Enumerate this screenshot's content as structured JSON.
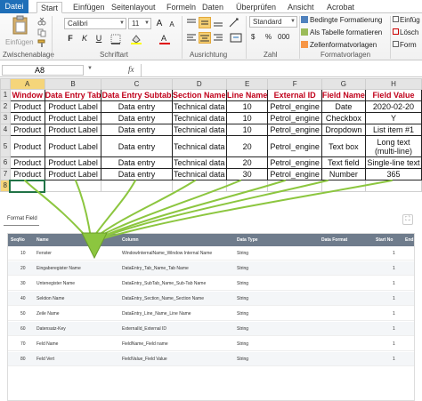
{
  "ribbon_tabs": [
    "Datei",
    "Start",
    "Einfügen",
    "Seitenlayout",
    "Formeln",
    "Daten",
    "Überprüfen",
    "Ansicht",
    "Acrobat"
  ],
  "clipboard": {
    "paste_label": "Einfügen",
    "group_label": "Zwischenablage"
  },
  "font": {
    "name": "Calibri",
    "size": "11",
    "bold": "F",
    "italic": "K",
    "underline": "U",
    "grow": "A",
    "shrink": "A",
    "group_label": "Schriftart"
  },
  "alignment": {
    "group_label": "Ausrichtung"
  },
  "number": {
    "format": "Standard",
    "currency": "$",
    "percent": "%",
    "thousands": "000",
    "group_label": "Zahl"
  },
  "styles": {
    "conditional": "Bedingte Formatierung",
    "as_table": "Als Tabelle formatieren",
    "cell_styles": "Zellenformatvorlagen",
    "group_label": "Formatvorlagen"
  },
  "cells_group": {
    "insert": "Einfüg",
    "delete": "Lösch",
    "format": "Form"
  },
  "formula_bar": {
    "cell_ref": "A8",
    "fx": "fx"
  },
  "sheet": {
    "columns": [
      "A",
      "B",
      "C",
      "D",
      "E",
      "F",
      "G",
      "H"
    ],
    "rows": [
      "1",
      "2",
      "3",
      "4",
      "5",
      "6",
      "7",
      "8"
    ],
    "header": [
      "Window",
      "Data Entry Tab",
      "Data Entry Subtab",
      "Section Name",
      "Line Name",
      "External ID",
      "Field Name",
      "Field Value"
    ],
    "data": [
      [
        "Product",
        "Product Label",
        "Data entry",
        "Technical data",
        "10",
        "Petrol_engine",
        "Date",
        "2020-02-20"
      ],
      [
        "Product",
        "Product Label",
        "Data entry",
        "Technical data",
        "10",
        "Petrol_engine",
        "Checkbox",
        "Y"
      ],
      [
        "Product",
        "Product Label",
        "Data entry",
        "Technical data",
        "10",
        "Petrol_engine",
        "Dropdown",
        "List item #1"
      ],
      [
        "Product",
        "Product Label",
        "Data entry",
        "Technical data",
        "20",
        "Petrol_engine",
        "Text box",
        "Long text (multi-line)"
      ],
      [
        "Product",
        "Product Label",
        "Data entry",
        "Technical data",
        "20",
        "Petrol_engine",
        "Text field",
        "Single-line text"
      ],
      [
        "Product",
        "Product Label",
        "Data entry",
        "Technical data",
        "30",
        "Petrol_engine",
        "Number",
        "365"
      ]
    ]
  },
  "panel": {
    "tab": "Format Field",
    "columns": [
      "SeqNo",
      "Name",
      "Column",
      "Data Type",
      "Data Format",
      "Start No",
      "End"
    ],
    "rows": [
      [
        "10",
        "Fenster",
        "WindowInternalName_Window Internal Name",
        "String",
        "",
        "1"
      ],
      [
        "20",
        "Eingaberegister Name",
        "DataEntry_Tab_Name_Tab Name",
        "String",
        "",
        "1"
      ],
      [
        "30",
        "Untenegister Name",
        "DataEntry_SubTab_Name_Sub-Tab Name",
        "String",
        "",
        "1"
      ],
      [
        "40",
        "Sektion Name",
        "DataEntry_Section_Name_Section Name",
        "String",
        "",
        "1"
      ],
      [
        "50",
        "Zeile Name",
        "DataEntry_Line_Name_Line Name",
        "String",
        "",
        "1"
      ],
      [
        "60",
        "Datensatz-Key",
        "ExternalId_External ID",
        "String",
        "",
        "1"
      ],
      [
        "70",
        "Feld Name",
        "FieldName_Field name",
        "String",
        "",
        "1"
      ],
      [
        "80",
        "Feld Vert",
        "FieldValue_Field Value",
        "String",
        "",
        "1"
      ]
    ]
  }
}
